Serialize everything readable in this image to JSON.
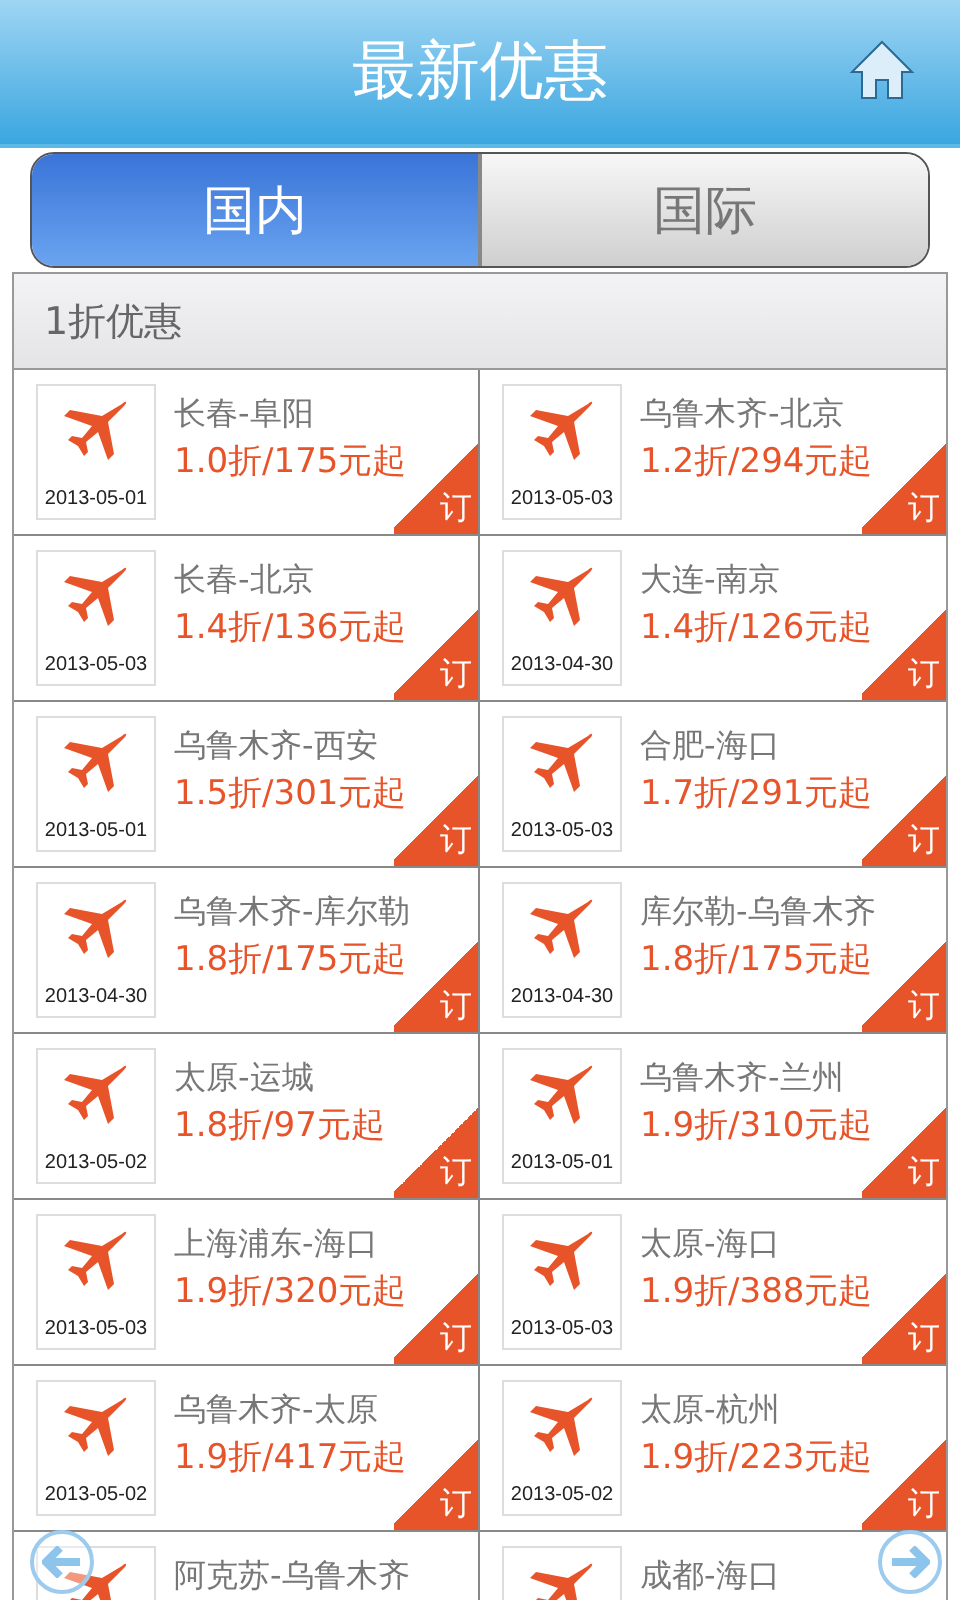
{
  "header": {
    "title": "最新优惠"
  },
  "tabs": [
    {
      "label": "国内",
      "selected": true
    },
    {
      "label": "国际",
      "selected": false
    }
  ],
  "section": {
    "title": "1折优惠"
  },
  "deals": [
    {
      "route": "长春-阜阳",
      "price": "1.0折/175元起",
      "date": "2013-05-01",
      "book": "订"
    },
    {
      "route": "乌鲁木齐-北京",
      "price": "1.2折/294元起",
      "date": "2013-05-03",
      "book": "订"
    },
    {
      "route": "长春-北京",
      "price": "1.4折/136元起",
      "date": "2013-05-03",
      "book": "订"
    },
    {
      "route": "大连-南京",
      "price": "1.4折/126元起",
      "date": "2013-04-30",
      "book": "订"
    },
    {
      "route": "乌鲁木齐-西安",
      "price": "1.5折/301元起",
      "date": "2013-05-01",
      "book": "订"
    },
    {
      "route": "合肥-海口",
      "price": "1.7折/291元起",
      "date": "2013-05-03",
      "book": "订"
    },
    {
      "route": "乌鲁木齐-库尔勒",
      "price": "1.8折/175元起",
      "date": "2013-04-30",
      "book": "订"
    },
    {
      "route": "库尔勒-乌鲁木齐",
      "price": "1.8折/175元起",
      "date": "2013-04-30",
      "book": "订"
    },
    {
      "route": "太原-运城",
      "price": "1.8折/97元起",
      "date": "2013-05-02",
      "book": "订"
    },
    {
      "route": "乌鲁木齐-兰州",
      "price": "1.9折/310元起",
      "date": "2013-05-01",
      "book": "订"
    },
    {
      "route": "上海浦东-海口",
      "price": "1.9折/320元起",
      "date": "2013-05-03",
      "book": "订"
    },
    {
      "route": "太原-海口",
      "price": "1.9折/388元起",
      "date": "2013-05-03",
      "book": "订"
    },
    {
      "route": "乌鲁木齐-太原",
      "price": "1.9折/417元起",
      "date": "2013-05-02",
      "book": "订"
    },
    {
      "route": "太原-杭州",
      "price": "1.9折/223元起",
      "date": "2013-05-02",
      "book": "订"
    },
    {
      "route": "阿克苏-乌鲁木齐"
    },
    {
      "route": "成都-海口"
    }
  ]
}
